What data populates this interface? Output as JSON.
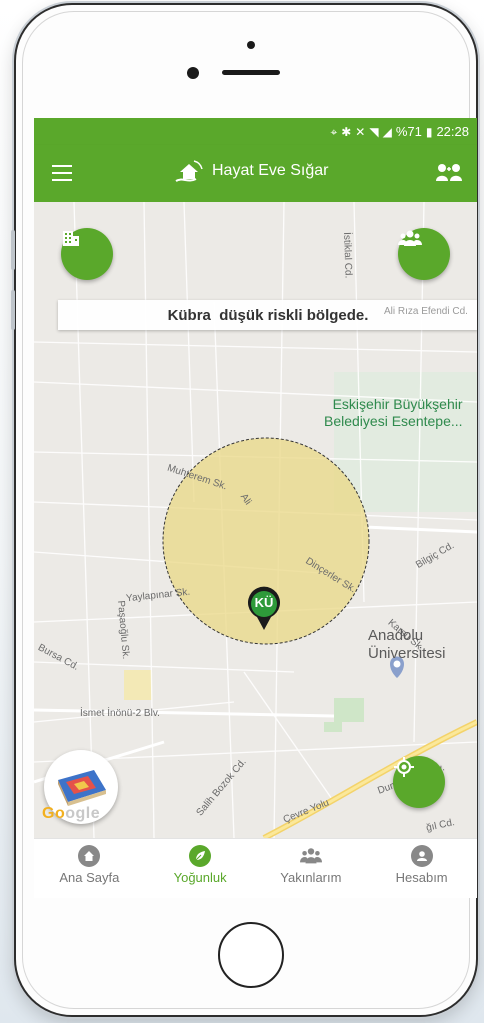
{
  "status_bar": {
    "battery": "%71",
    "time": "22:28"
  },
  "app_bar": {
    "title": "Hayat Eve Sığar"
  },
  "map": {
    "banner": "Kübra  düşük riskli bölgede.",
    "marker_initials": "KÜ",
    "street_labels": {
      "muhterem": "Muhterem Sk.",
      "ali": "Ali",
      "dincerler": "Dinçerler Sk.",
      "yaylapinar": "Yaylapınar Sk.",
      "pasaoglu": "Paşaoğlu Sk.",
      "bursa": "Bursa Cd.",
      "ismet": "İsmet İnönü-2 Blv.",
      "salih": "Salih Bozok Cd.",
      "cevre": "Çevre Yolu",
      "dumlupinar": "Dumlupınar Blv.",
      "karsu": "Karsu Sk.",
      "bilgic": "Bilgiç Cd.",
      "istiklal": "İstiklal Cd.",
      "ali_riza": "Ali Rıza Efendi Cd.",
      "gisli": "ğıl Cd."
    },
    "poi_municipality": [
      "Eskişehir Büyükşehir",
      "Belediyesi Esentepe..."
    ],
    "poi_university": [
      "Anadolu",
      "Üniversitesi"
    ],
    "google_logo": "Google",
    "zone_color": "#e9d886",
    "accent_color": "#5aa82b"
  },
  "bottom_nav": [
    {
      "label": "Ana Sayfa",
      "icon": "home-icon",
      "active": false
    },
    {
      "label": "Yoğunluk",
      "icon": "leaf-icon",
      "active": true
    },
    {
      "label": "Yakınlarım",
      "icon": "people-icon",
      "active": false
    },
    {
      "label": "Hesabım",
      "icon": "account-icon",
      "active": false
    }
  ]
}
